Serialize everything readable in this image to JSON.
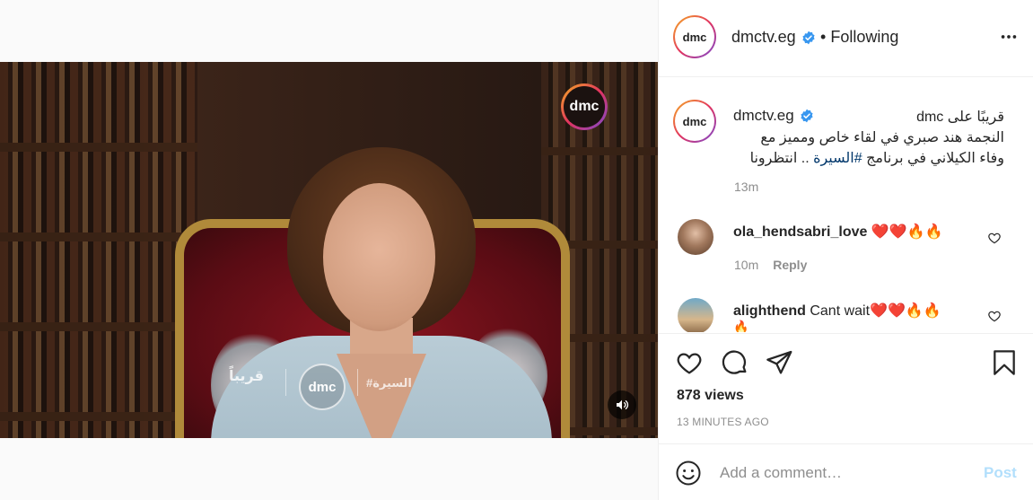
{
  "header": {
    "username": "dmctv.eg",
    "bullet": "•",
    "follow_state": "Following",
    "avatar_text": "dmc"
  },
  "video": {
    "watermark_logo": "dmc",
    "promo_left_text": "قريباً",
    "promo_logo": "dmc",
    "promo_right_text": "#السيرة"
  },
  "caption": {
    "username": "dmctv.eg",
    "avatar_text": "dmc",
    "text_line1": "قريبًا على dmc",
    "text_line2": "النجمة هند صبري في لقاء خاص ومميز مع",
    "text_line3_pre": "وفاء الكيلاني في برنامج ",
    "hashtag": "#السيرة",
    "text_line3_post": " .. انتظرونا",
    "time": "13m"
  },
  "comments": [
    {
      "username": "ola_hendsabri_love",
      "text": " ❤️❤️🔥🔥",
      "time": "10m",
      "reply_label": "Reply"
    },
    {
      "username": "alighthend",
      "text": " Cant wait❤️❤️🔥🔥",
      "overflow": "🔥"
    }
  ],
  "stats": {
    "views": "878 views",
    "time_ago": "13 MINUTES AGO"
  },
  "composer": {
    "placeholder": "Add a comment…",
    "post_label": "Post"
  },
  "colors": {
    "verified": "#3897f0",
    "post_disabled": "#b2dffc",
    "hashtag": "#00376b"
  }
}
